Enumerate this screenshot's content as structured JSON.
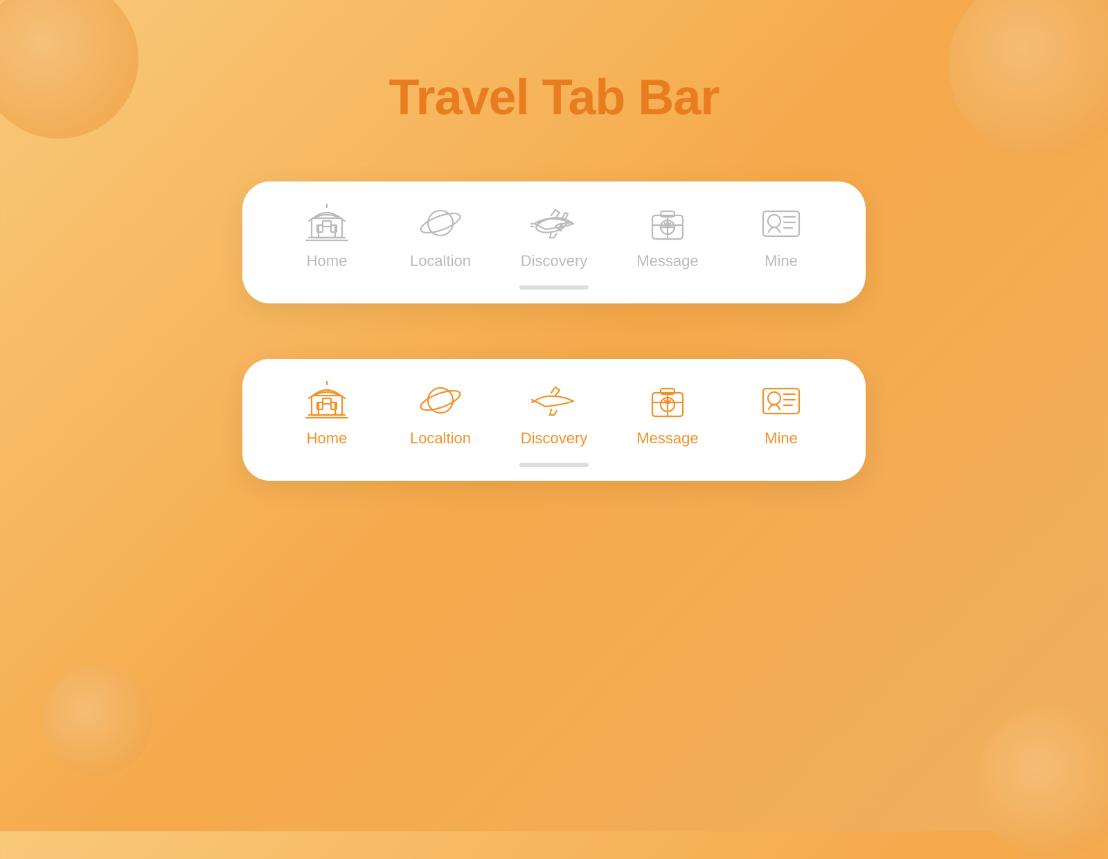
{
  "page": {
    "title": "Travel Tab Bar",
    "background_gradient_start": "#f9c97a",
    "background_gradient_end": "#f0b060",
    "accent_color": "#e87c1e",
    "orange": "#f0922b"
  },
  "tab_bars": [
    {
      "id": "inactive-bar",
      "state": "inactive",
      "items": [
        {
          "id": "home",
          "label": "Home"
        },
        {
          "id": "location",
          "label": "Localtion"
        },
        {
          "id": "discovery",
          "label": "Discovery"
        },
        {
          "id": "message",
          "label": "Message"
        },
        {
          "id": "mine",
          "label": "Mine"
        }
      ]
    },
    {
      "id": "active-bar",
      "state": "active",
      "items": [
        {
          "id": "home",
          "label": "Home"
        },
        {
          "id": "location",
          "label": "Localtion"
        },
        {
          "id": "discovery",
          "label": "Discovery"
        },
        {
          "id": "message",
          "label": "Message"
        },
        {
          "id": "mine",
          "label": "Mine"
        }
      ]
    }
  ]
}
